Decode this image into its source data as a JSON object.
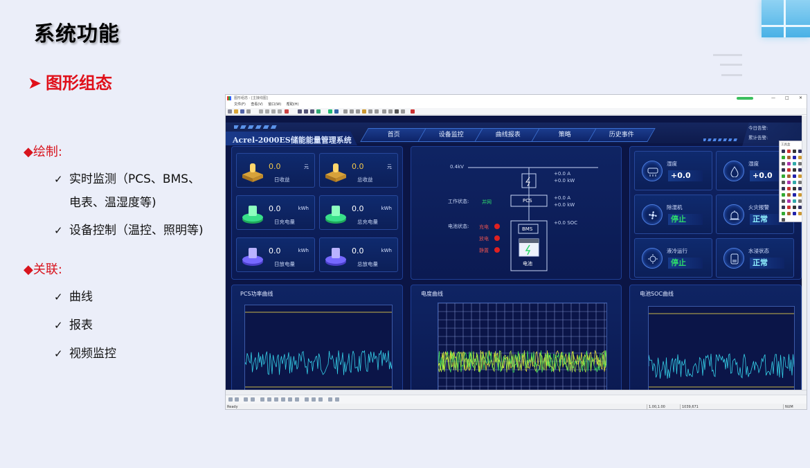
{
  "slide": {
    "title": "系统功能",
    "subtitle": "图形组态",
    "section1": "◆绘制:",
    "section1_items": [
      "实时监测（PCS、BMS、",
      "电表、温湿度等)",
      "设备控制（温控、照明等)"
    ],
    "section2": "◆关联:",
    "section2_items": [
      "曲线",
      "报表",
      "视频监控"
    ],
    "checkmark": "✓"
  },
  "app": {
    "window_title": "图形组态 - [主接线图]",
    "menu": [
      "文件(F)",
      "查看(V)",
      "窗口(W)",
      "帮助(H)"
    ],
    "status_ready": "Ready",
    "status_coords": "1.00,1.00",
    "status_size": "1039,671",
    "status_num": "NUM",
    "toolbox_title": "工具盒"
  },
  "hmi": {
    "system_name": "Acrel-2000ES储能能量管理系统",
    "tabs": [
      "首页",
      "设备监控",
      "曲线报表",
      "策略",
      "历史事件"
    ],
    "alarm_today": "今日告警:",
    "alarm_total": "累计告警:",
    "stats": [
      {
        "value": "0.0",
        "unit": "元",
        "label": "日收益",
        "icon": "gold-coin-icon"
      },
      {
        "value": "0.0",
        "unit": "元",
        "label": "总收益",
        "icon": "gold-coin-icon"
      },
      {
        "value": "0.0",
        "unit": "kWh",
        "label": "日充电量",
        "icon": "green-battery-icon"
      },
      {
        "value": "0.0",
        "unit": "kWh",
        "label": "总充电量",
        "icon": "green-battery-icon"
      },
      {
        "value": "0.0",
        "unit": "kWh",
        "label": "日放电量",
        "icon": "purple-discharge-icon"
      },
      {
        "value": "0.0",
        "unit": "kWh",
        "label": "总放电量",
        "icon": "purple-discharge-icon"
      }
    ],
    "diagram": {
      "bus_voltage": "0.4kV",
      "meter_a": "+0.0  A",
      "meter_kw": "+0.0  kW",
      "pcs_label": "PCS",
      "pcs_a": "+0.0  A",
      "pcs_kw": "+0.0  kW",
      "work_state_label": "工作状态:",
      "work_state_value": "并网",
      "battery_state_label": "电池状态:",
      "states": [
        "充电",
        "放电",
        "静置"
      ],
      "bms_label": "BMS",
      "soc_value": "+0.0  SOC",
      "battery_label": "电池"
    },
    "env": [
      {
        "name": "湿度",
        "value": "+0.0",
        "icon": "air-conditioner-icon"
      },
      {
        "name": "湿度",
        "value": "+0.0",
        "icon": "water-drop-icon"
      },
      {
        "name": "除湿机",
        "value": "停止",
        "icon": "fan-icon"
      },
      {
        "name": "火灾报警",
        "value": "正常",
        "icon": "fire-alarm-icon"
      },
      {
        "name": "液冷运行",
        "value": "停止",
        "icon": "cooling-icon"
      },
      {
        "name": "水浸状态",
        "value": "正常",
        "icon": "water-sensor-icon"
      }
    ],
    "env_unit": "℃",
    "charts": [
      "PCS功率曲线",
      "电度曲线",
      "电池SOC曲线"
    ]
  }
}
